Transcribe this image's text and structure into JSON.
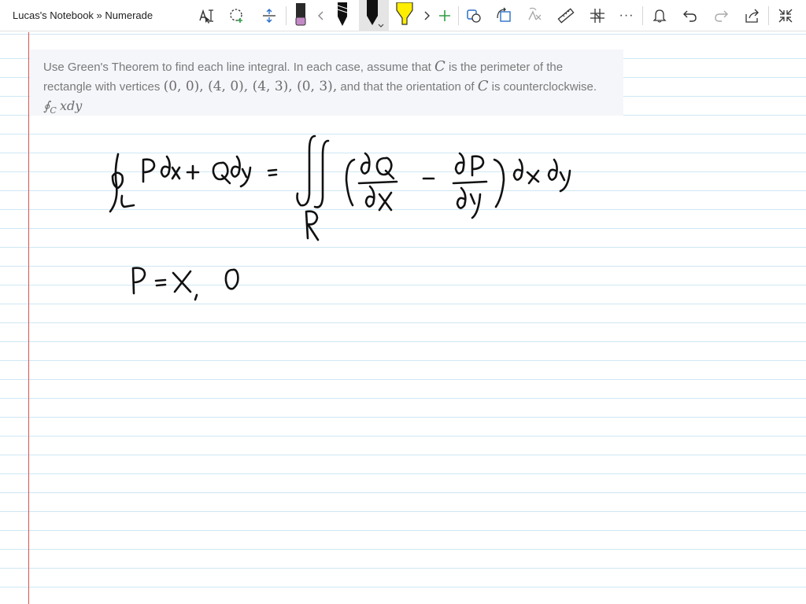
{
  "window": {
    "title": "Lucas's Notebook » Numerade"
  },
  "toolbar": {
    "icons": [
      "text-select-icon",
      "lasso-select-icon",
      "insert-space-icon",
      "eraser-icon",
      "chevron-left-icon",
      "pen-black-icon",
      "pen-black-selected-icon",
      "highlighter-yellow-icon",
      "chevron-right-icon",
      "add-pen-icon",
      "shapes-icon",
      "ink-to-shape-icon",
      "ink-to-math-icon",
      "ruler-icon",
      "lock-background-icon",
      "more-icon",
      "notifications-icon",
      "undo-icon",
      "redo-icon",
      "share-icon",
      "fullscreen-icon"
    ],
    "more_label": "···",
    "colors": {
      "eraser_pink": "#c389c7",
      "highlighter_yellow": "#ffee00",
      "add_green": "#2e9e44",
      "accent_blue": "#2b6fc9"
    }
  },
  "problem": {
    "line1_a": "Use Green's Theorem to find each line integral. In each case, assume that",
    "line1_var": "C",
    "line1_b": "is the perimeter of the",
    "line2_a": "rectangle with vertices",
    "vertices": "(0, 0), (4, 0), (4, 3), (0, 3),",
    "line2_b": "and that the orientation of",
    "line2_var": "C",
    "line2_c": "is counterclockwise.",
    "integral": "∮",
    "integral_sub": "C",
    "integrand": "xdy"
  },
  "page": {
    "rule_color": "#cfe7f3",
    "margin_color": "#d9534f",
    "problem_bg": "#f5f6fa"
  }
}
